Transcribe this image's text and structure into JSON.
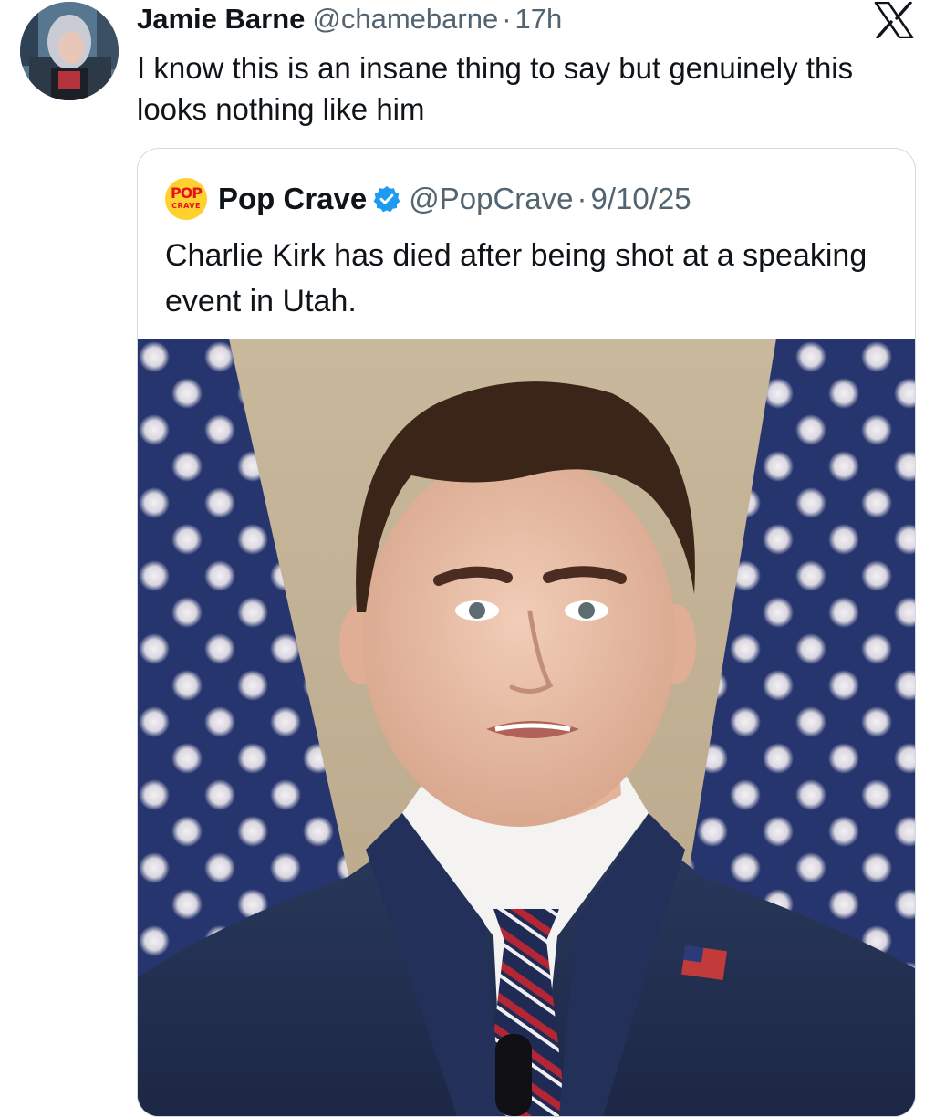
{
  "tweet": {
    "author_name": "Jamie Barne",
    "handle": "@chamebarne",
    "separator": "·",
    "time": "17h",
    "text": "I know this is an insane thing to say but genuinely this looks nothing like him",
    "avatar_icon": "profile-avatar"
  },
  "platform": {
    "logo_icon": "x-logo"
  },
  "quoted": {
    "logo_icon": "pop-crave-logo",
    "logo_text_top": "POP",
    "logo_text_bottom": "CRAVE",
    "author_name": "Pop Crave",
    "verified_icon": "verified-badge-icon",
    "handle": "@PopCrave",
    "separator": "·",
    "date": "9/10/25",
    "text": "Charlie Kirk has died after being shot at a speaking event in Utah."
  },
  "colors": {
    "text_primary": "#0f1419",
    "text_secondary": "#536471",
    "border": "#cfd9de",
    "verified_blue": "#1d9bf0"
  }
}
